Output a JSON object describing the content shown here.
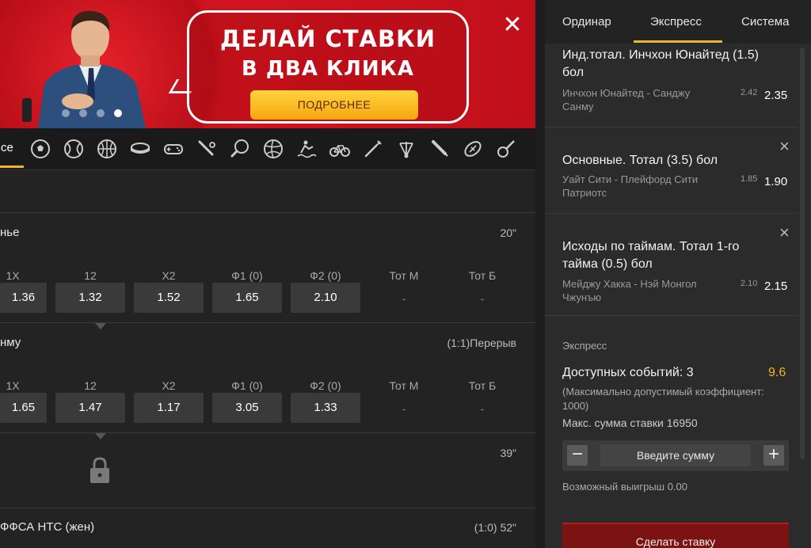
{
  "banner": {
    "line1": "ДЕЛАЙ СТАВКИ",
    "line2": "В ДВА КЛИКА",
    "button": "ПОДРОБНЕЕ",
    "close": "✕"
  },
  "sports": {
    "all_label": "Все",
    "icons": [
      "soccer-icon",
      "tennis-icon",
      "basketball-icon",
      "hockey-icon",
      "esports-icon",
      "baseball-icon",
      "table-tennis-icon",
      "volleyball-icon",
      "water-sport-icon",
      "cycling-icon",
      "darts-icon",
      "badminton-icon",
      "cricket-icon",
      "rugby-icon",
      "racket-icon"
    ]
  },
  "matches": [
    {
      "title": "нье",
      "status": "20\"",
      "columns": [
        "1X",
        "12",
        "X2",
        "Ф1 (0)",
        "Ф2 (0)",
        "Тот М",
        "Тот Б"
      ],
      "odds": [
        "1.36",
        "1.32",
        "1.52",
        "1.65",
        "2.10",
        "-",
        "-"
      ]
    },
    {
      "title": "нму",
      "status": "(1:1)Перерыв",
      "columns": [
        "1X",
        "12",
        "X2",
        "Ф1 (0)",
        "Ф2 (0)",
        "Тот М",
        "Тот Б"
      ],
      "odds": [
        "1.65",
        "1.47",
        "1.17",
        "3.05",
        "1.33",
        "-",
        "-"
      ]
    },
    {
      "title": "",
      "status": "39\""
    },
    {
      "title": "ФФСА НТС (жен)",
      "status": "(1:0) 52\""
    }
  ],
  "betslip": {
    "tabs": [
      "Ординар",
      "Экспресс",
      "Система"
    ],
    "active_tab": "Экспресс",
    "bets": [
      {
        "title": "Инд.тотал. Инчхон Юнайтед (1.5) бол",
        "teams": "Инчхон Юнайтед - Санджу Санму",
        "old": "2.42",
        "new": "2.35"
      },
      {
        "title": "Основные. Тотал (3.5) бол",
        "teams": "Уайт Сити - Плейфорд Сити Патриотс",
        "old": "1.85",
        "new": "1.90"
      },
      {
        "title": "Исходы по таймам. Тотал 1-го тайма (0.5) бол",
        "teams": "Мейджу Хакка - Нэй Монгол Чжунъю",
        "old": "2.10",
        "new": "2.15"
      }
    ],
    "express_label": "Экспресс",
    "available": "Доступных событий: 3",
    "coef": "9.6",
    "max_coef": "(Максимально допустимый коэффициент: 1000)",
    "max_sum": "Макс. сумма ставки 16950",
    "stake_placeholder": "Введите сумму",
    "minus": "−",
    "plus": "+",
    "possible_win": "Возможный выигрыш 0.00",
    "place_bet": "Сделать ставку"
  },
  "colors": {
    "accent": "#f0b429",
    "brand_red": "#c8141e",
    "place_bet": "#7b1313"
  }
}
